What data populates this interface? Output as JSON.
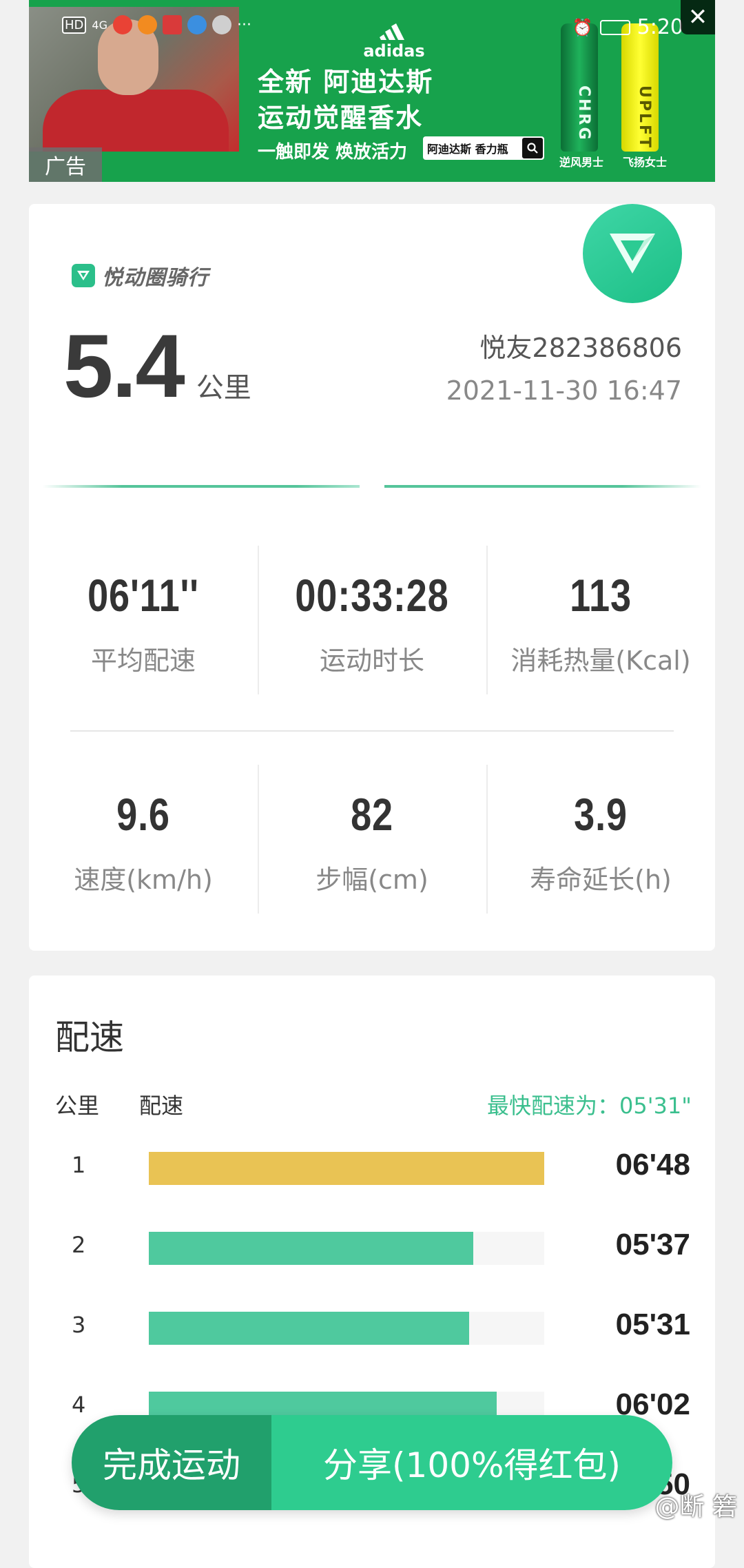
{
  "status_bar": {
    "left_badge": "HD",
    "network": "4G",
    "more": "···",
    "time": "5:20"
  },
  "ad": {
    "tag": "广告",
    "brand": "adidas",
    "headline_1": "全新 阿迪达斯",
    "headline_2": "运动觉醒香水",
    "tagline": "一触即发 焕放活力",
    "search_text": "阿迪达斯 香力瓶",
    "bottle_green_text": "CHRG",
    "bottle_yellow_text": "UPLFT",
    "bottle_green_label": "逆风男士",
    "bottle_yellow_label": "飞扬女士"
  },
  "summary": {
    "app_name": "悦动圈骑行",
    "distance": "5.4",
    "distance_unit": "公里",
    "user": "悦友282386806",
    "datetime": "2021-11-30 16:47",
    "stats_row1": [
      {
        "value": "06'11''",
        "label": "平均配速"
      },
      {
        "value": "00:33:28",
        "label": "运动时长"
      },
      {
        "value": "113",
        "label": "消耗热量(Kcal)"
      }
    ],
    "stats_row2": [
      {
        "value": "9.6",
        "label": "速度(km/h)"
      },
      {
        "value": "82",
        "label": "步幅(cm)"
      },
      {
        "value": "3.9",
        "label": "寿命延长(h)"
      }
    ]
  },
  "pace": {
    "title": "配速",
    "col_km": "公里",
    "col_pace": "配速",
    "fastest": "最快配速为：05'31\"",
    "colors": {
      "slowest": "#e9c354",
      "normal": "#4fc99e"
    },
    "rows": [
      {
        "km": "1",
        "time": "06'48",
        "fill": 1.0,
        "slowest": true
      },
      {
        "km": "2",
        "time": "05'37",
        "fill": 0.82,
        "slowest": false
      },
      {
        "km": "3",
        "time": "05'31",
        "fill": 0.81,
        "slowest": false
      },
      {
        "km": "4",
        "time": "06'02",
        "fill": 0.88,
        "slowest": false
      },
      {
        "km": "5",
        "time": "06'50",
        "fill": 1.0,
        "slowest": false
      }
    ]
  },
  "actions": {
    "finish": "完成运动",
    "share": "分享(100%得红包)"
  },
  "watermark": "@断 箬"
}
